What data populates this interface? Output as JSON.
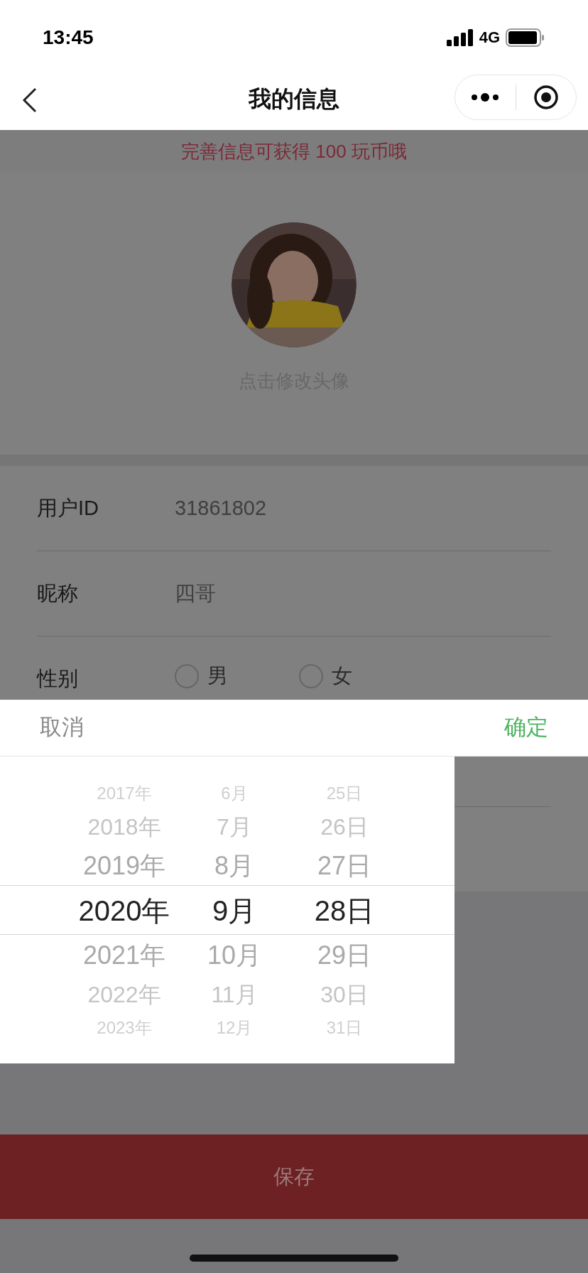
{
  "status_bar": {
    "time": "13:45",
    "network": "4G"
  },
  "nav": {
    "title": "我的信息"
  },
  "banner": {
    "text": "完善信息可获得 100 玩币哦"
  },
  "avatar": {
    "kind": "picture",
    "caption": "点击修改头像"
  },
  "form": {
    "rows": [
      {
        "kind": "text",
        "label": "用户ID",
        "value": "31861802"
      },
      {
        "kind": "text",
        "label": "昵称",
        "value": "四哥"
      },
      {
        "kind": "radio",
        "label": "性别",
        "options": [
          {
            "label": "男",
            "selected": false
          },
          {
            "label": "女",
            "selected": false
          }
        ]
      }
    ]
  },
  "picker": {
    "cancel": "取消",
    "confirm": "确定",
    "columns": [
      {
        "items": [
          {
            "label": "2017年",
            "selected": false
          },
          {
            "label": "2018年",
            "selected": false
          },
          {
            "label": "2019年",
            "selected": false
          },
          {
            "label": "2020年",
            "selected": true
          },
          {
            "label": "2021年",
            "selected": false
          },
          {
            "label": "2022年",
            "selected": false
          },
          {
            "label": "2023年",
            "selected": false
          }
        ]
      },
      {
        "items": [
          {
            "label": "6月",
            "selected": false
          },
          {
            "label": "7月",
            "selected": false
          },
          {
            "label": "8月",
            "selected": false
          },
          {
            "label": "9月",
            "selected": true
          },
          {
            "label": "10月",
            "selected": false
          },
          {
            "label": "11月",
            "selected": false
          },
          {
            "label": "12月",
            "selected": false
          }
        ]
      },
      {
        "items": [
          {
            "label": "25日",
            "selected": false
          },
          {
            "label": "26日",
            "selected": false
          },
          {
            "label": "27日",
            "selected": false
          },
          {
            "label": "28日",
            "selected": true
          },
          {
            "label": "29日",
            "selected": false
          },
          {
            "label": "30日",
            "selected": false
          },
          {
            "label": "31日",
            "selected": false
          }
        ]
      }
    ]
  },
  "save_button": {
    "label": "保存"
  }
}
